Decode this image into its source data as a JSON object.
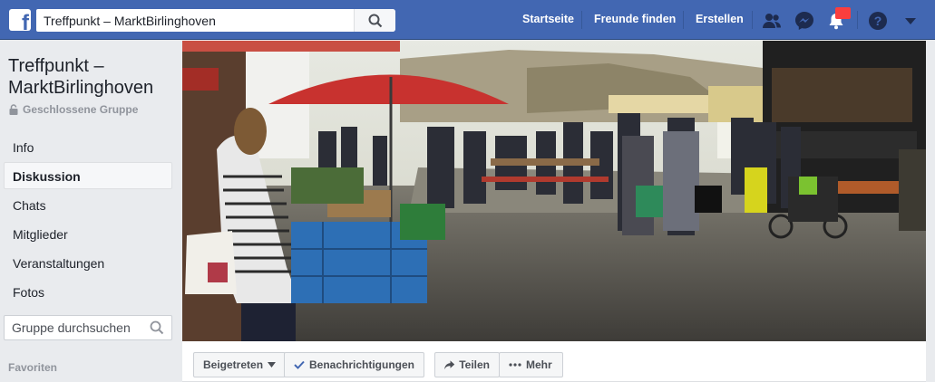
{
  "header": {
    "brand_icon": "facebook-logo",
    "search_value": "Treffpunkt – MarktBirlinghoven",
    "nav": [
      "Startseite",
      "Freunde finden",
      "Erstellen"
    ],
    "icons": [
      "friend-requests-icon",
      "messenger-icon",
      "notifications-icon",
      "help-icon",
      "account-menu-icon"
    ],
    "accent_color": "#4267b2",
    "badge_color": "#fa3e3e"
  },
  "group": {
    "title": "Treffpunkt – MarktBirlinghoven",
    "privacy": "Geschlossene Gruppe"
  },
  "sidebar": {
    "items": [
      {
        "label": "Info"
      },
      {
        "label": "Diskussion",
        "active": true
      },
      {
        "label": "Chats"
      },
      {
        "label": "Mitglieder"
      },
      {
        "label": "Veranstaltungen"
      },
      {
        "label": "Fotos"
      }
    ],
    "search_placeholder": "Gruppe durchsuchen",
    "favorites_title": "Favoriten"
  },
  "cover": {
    "description_icon": "cover-photo"
  },
  "actions": {
    "joined": "Beigetreten",
    "notifications": "Benachrichtigungen",
    "share": "Teilen",
    "more": "Mehr"
  }
}
